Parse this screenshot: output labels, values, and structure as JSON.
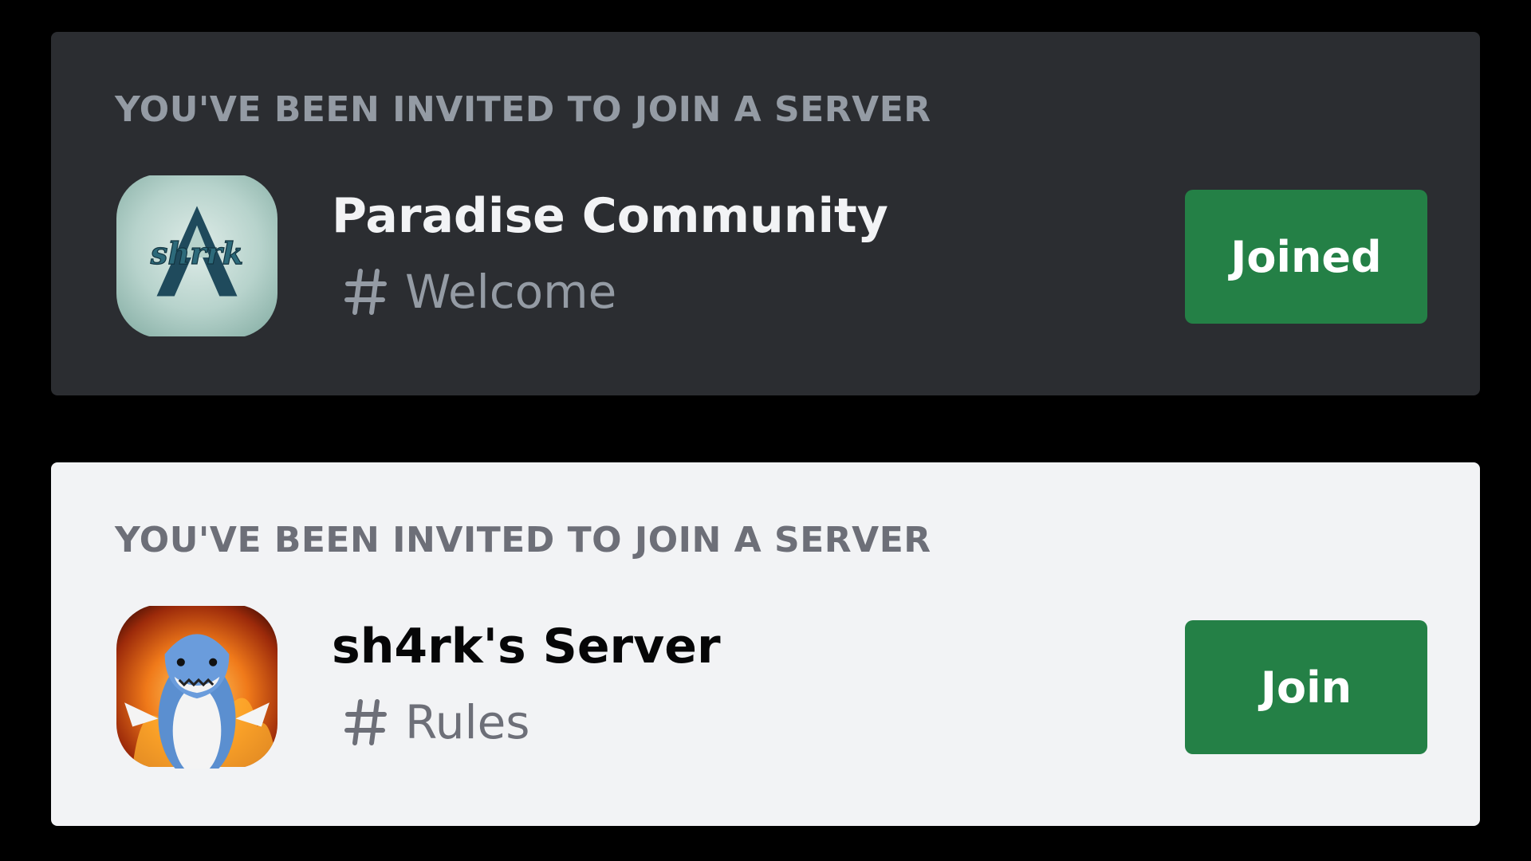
{
  "invites": [
    {
      "theme": "dark",
      "header": "YOU'VE BEEN INVITED TO JOIN A SERVER",
      "server_name": "Paradise Community",
      "channel_name": "Welcome",
      "channel_icon": "hash-icon",
      "server_icon": "sh4rk-logo-icon",
      "button_label": "Joined"
    },
    {
      "theme": "light",
      "header": "YOU'VE BEEN INVITED TO JOIN A SERVER",
      "server_name": "sh4rk's Server",
      "channel_name": "Rules",
      "channel_icon": "hash-icon",
      "server_icon": "shark-fire-avatar-icon",
      "button_label": "Join"
    }
  ],
  "colors": {
    "dark_card_bg": "#2b2d31",
    "light_card_bg": "#f2f3f5",
    "button_green": "#248046",
    "muted_text_dark": "#949ba4",
    "muted_text_light": "#6d6f78"
  }
}
